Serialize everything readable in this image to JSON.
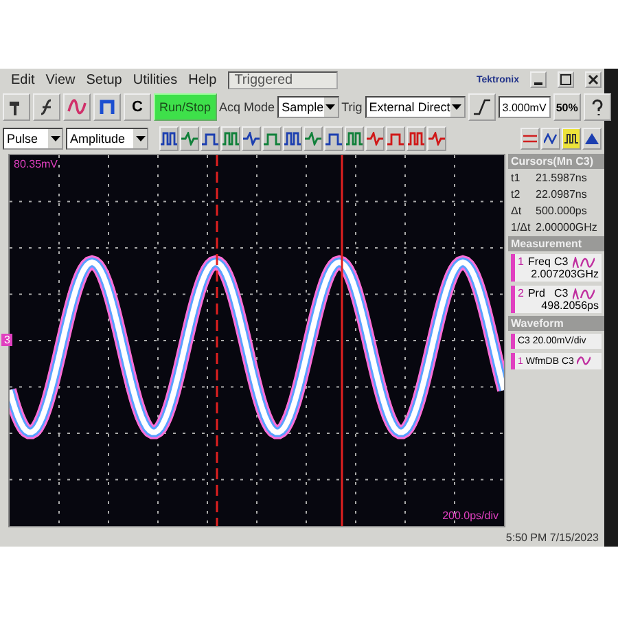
{
  "menu": [
    {
      "label": "Edit"
    },
    {
      "label": "View"
    },
    {
      "label": "Setup"
    },
    {
      "label": "Utilities"
    },
    {
      "label": "Help"
    }
  ],
  "status": "Triggered",
  "brand": "Tektronix",
  "toolbar": {
    "c_label": "C",
    "run_stop": "Run/Stop",
    "acq_label": "Acq Mode",
    "acq_mode": "Sample",
    "trig_label": "Trig",
    "trig_source": "External Direct",
    "trig_level": "3.000mV",
    "fifty": "50%"
  },
  "meas_bar": {
    "type": "Pulse",
    "param": "Amplitude"
  },
  "display": {
    "top_reading": "80.35mV",
    "channel_marker": "3",
    "timebase": "200.0ps/div"
  },
  "side": {
    "cursors_title": "Cursors(Mn C3)",
    "cursors": [
      {
        "label": "t1",
        "value": "21.5987ns"
      },
      {
        "label": "t2",
        "value": "22.0987ns"
      },
      {
        "label": "Δt",
        "value": "500.000ps"
      },
      {
        "label": "1/Δt",
        "value": "2.00000GHz"
      }
    ],
    "measurement_title": "Measurement",
    "measurements": [
      {
        "index": "1",
        "name": "Freq",
        "source": "C3",
        "value": "2.007203GHz"
      },
      {
        "index": "2",
        "name": "Prd",
        "source": "C3",
        "value": "498.2056ps"
      }
    ],
    "waveform_title": "Waveform",
    "waveforms": [
      {
        "text": "C3 20.00mV/div"
      },
      {
        "index": "1",
        "text": "WfmDB C3"
      }
    ]
  },
  "clock": "5:50 PM 7/15/2023"
}
